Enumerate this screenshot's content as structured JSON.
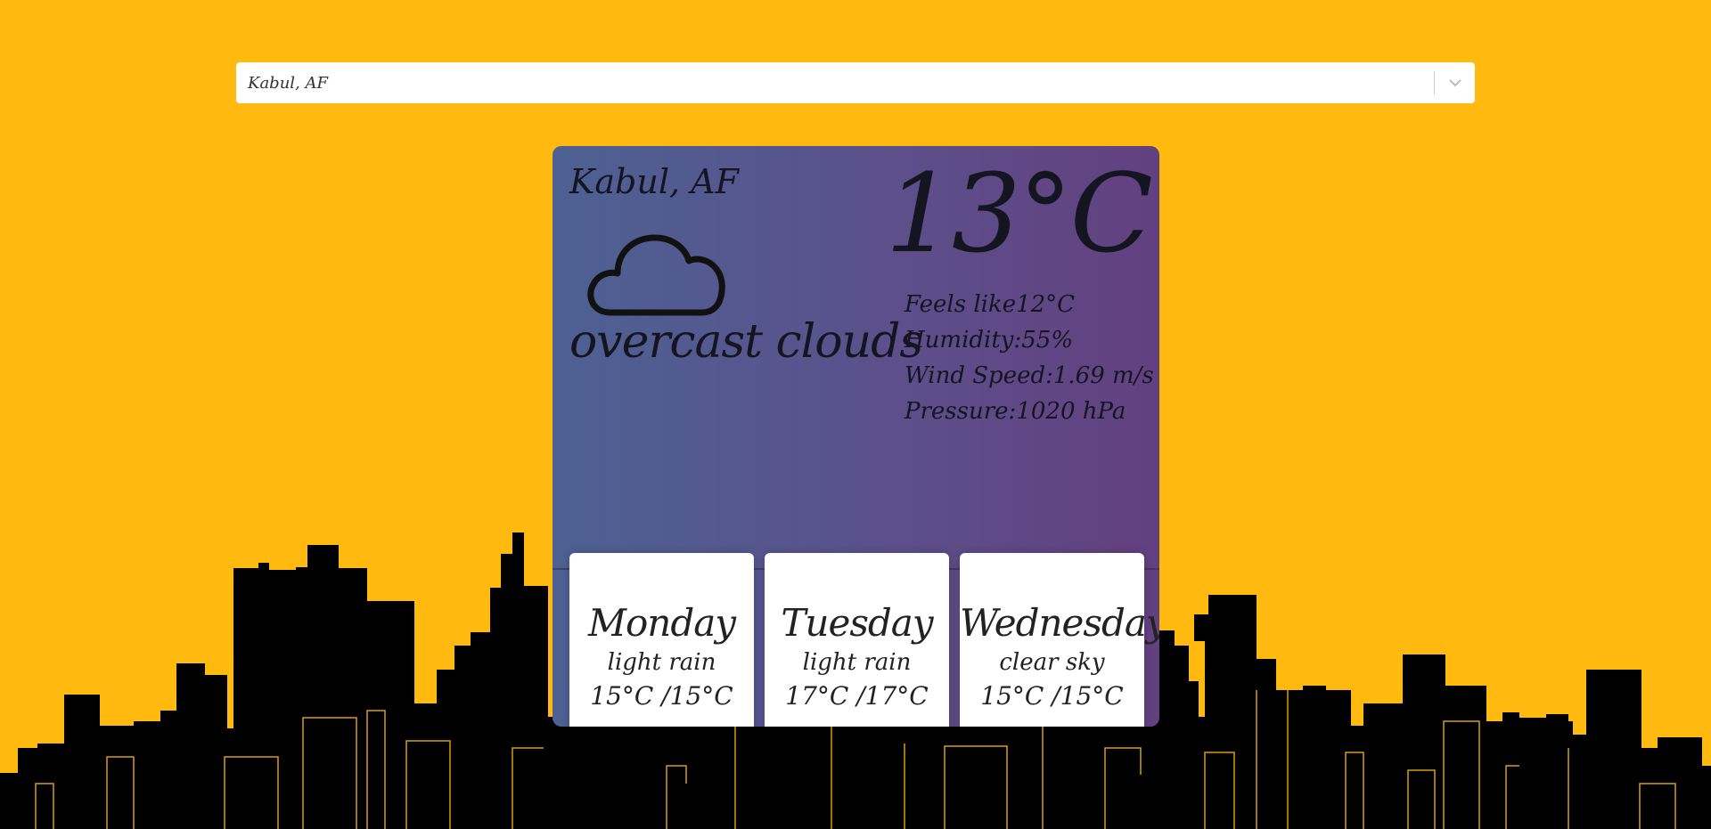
{
  "search": {
    "value": "Kabul, AF"
  },
  "current": {
    "city": "Kabul, AF",
    "icon": "cloud-icon",
    "description": "overcast clouds",
    "temperature": "13°C",
    "feels_like": "Feels like12°C",
    "humidity": "Humidity:55%",
    "wind_speed": "Wind Speed:1.69 m/s",
    "pressure": "Pressure:1020 hPa"
  },
  "forecast": [
    {
      "day": "Monday",
      "description": "light rain",
      "range": "15°C /15°C"
    },
    {
      "day": "Tuesday",
      "description": "light rain",
      "range": "17°C /17°C"
    },
    {
      "day": "Wednesday",
      "description": "clear sky",
      "range": "15°C /15°C"
    }
  ],
  "colors": {
    "background": "#ffb90f",
    "card_gradient_start": "#4d6193",
    "card_gradient_end": "#63407f",
    "skyline": "#000000"
  }
}
